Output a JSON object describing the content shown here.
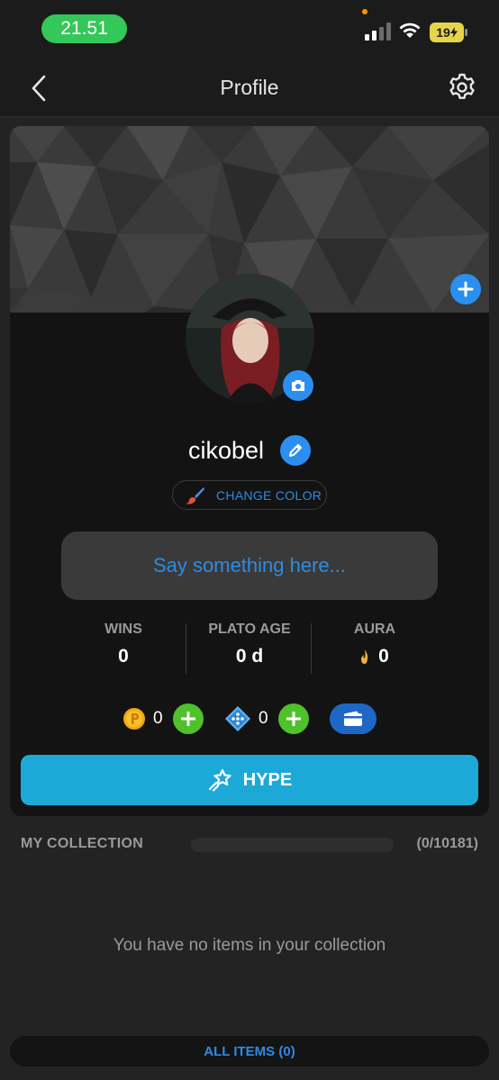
{
  "status_bar": {
    "time": "21.51",
    "battery": "19"
  },
  "header": {
    "title": "Profile",
    "back_icon": "chevron-left-icon",
    "settings_icon": "gear-icon"
  },
  "profile": {
    "username": "cikobel",
    "change_color_label": "CHANGE COLOR",
    "bio_placeholder": "Say something here...",
    "stats": [
      {
        "label": "WINS",
        "value": "0"
      },
      {
        "label": "PLATO AGE",
        "value": "0 d"
      },
      {
        "label": "AURA",
        "value": "0"
      }
    ],
    "coins": "0",
    "gems": "0",
    "hype_label": "HYPE"
  },
  "collection": {
    "title": "MY COLLECTION",
    "count": "(0/10181)",
    "progress": 0,
    "empty_text": "You have no items in your collection",
    "all_items_label": "ALL ITEMS (0)"
  },
  "colors": {
    "accent_blue": "#2b8ff0",
    "hype_cyan": "#1da9d8",
    "add_green": "#4fc12a",
    "status_green": "#34c759"
  }
}
